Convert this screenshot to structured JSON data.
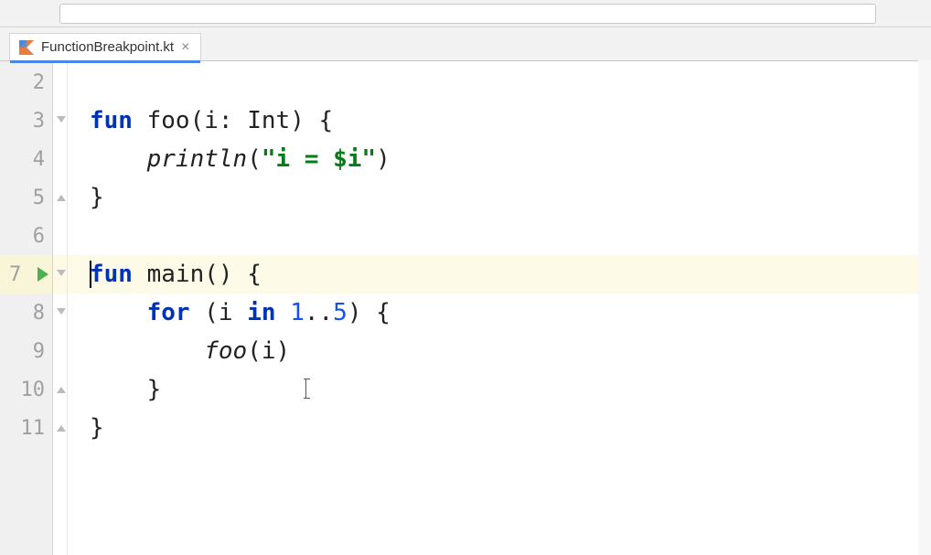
{
  "tab": {
    "filename": "FunctionBreakpoint.kt",
    "close": "×"
  },
  "gutter": {
    "lines": [
      "2",
      "3",
      "4",
      "5",
      "6",
      "7",
      "8",
      "9",
      "10",
      "11"
    ],
    "highlighted_index": 5,
    "run_icon_index": 5
  },
  "code": {
    "lines": [
      {
        "hl": false,
        "segments": []
      },
      {
        "hl": false,
        "fold": "start",
        "segments": [
          {
            "cls": "kw",
            "t": "fun"
          },
          {
            "cls": "punct",
            "t": " "
          },
          {
            "cls": "fn-decl",
            "t": "foo"
          },
          {
            "cls": "punct",
            "t": "("
          },
          {
            "cls": "param",
            "t": "i"
          },
          {
            "cls": "punct",
            "t": ": "
          },
          {
            "cls": "type",
            "t": "Int"
          },
          {
            "cls": "punct",
            "t": ") {"
          }
        ]
      },
      {
        "hl": false,
        "segments": [
          {
            "cls": "punct",
            "t": "    "
          },
          {
            "cls": "call",
            "t": "println"
          },
          {
            "cls": "punct",
            "t": "("
          },
          {
            "cls": "str",
            "t": "\"i = "
          },
          {
            "cls": "str",
            "t": "$i"
          },
          {
            "cls": "str",
            "t": "\""
          },
          {
            "cls": "punct",
            "t": ")"
          }
        ]
      },
      {
        "hl": false,
        "fold": "end",
        "segments": [
          {
            "cls": "punct",
            "t": "}"
          }
        ]
      },
      {
        "hl": false,
        "segments": []
      },
      {
        "hl": true,
        "fold": "start",
        "caret": true,
        "segments": [
          {
            "cls": "kw",
            "t": "fun"
          },
          {
            "cls": "punct",
            "t": " "
          },
          {
            "cls": "fn-decl",
            "t": "main"
          },
          {
            "cls": "punct",
            "t": "() {"
          }
        ]
      },
      {
        "hl": false,
        "fold": "start",
        "segments": [
          {
            "cls": "punct",
            "t": "    "
          },
          {
            "cls": "kw",
            "t": "for"
          },
          {
            "cls": "punct",
            "t": " ("
          },
          {
            "cls": "param",
            "t": "i"
          },
          {
            "cls": "punct",
            "t": " "
          },
          {
            "cls": "kw",
            "t": "in"
          },
          {
            "cls": "punct",
            "t": " "
          },
          {
            "cls": "num",
            "t": "1"
          },
          {
            "cls": "punct",
            "t": ".."
          },
          {
            "cls": "num",
            "t": "5"
          },
          {
            "cls": "punct",
            "t": ") {"
          }
        ]
      },
      {
        "hl": false,
        "segments": [
          {
            "cls": "punct",
            "t": "        "
          },
          {
            "cls": "call",
            "t": "foo"
          },
          {
            "cls": "punct",
            "t": "(i)"
          }
        ]
      },
      {
        "hl": false,
        "fold": "end",
        "segments": [
          {
            "cls": "punct",
            "t": "    }"
          }
        ],
        "ibeam": true
      },
      {
        "hl": false,
        "fold": "end",
        "segments": [
          {
            "cls": "punct",
            "t": "}"
          }
        ]
      }
    ]
  }
}
